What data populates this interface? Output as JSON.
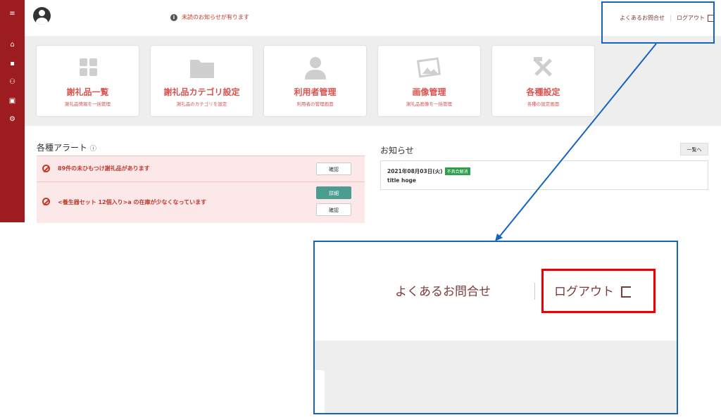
{
  "sidebar": {
    "items": [
      {
        "icon": "menu-icon",
        "glyph": "≡"
      },
      {
        "icon": "home-icon",
        "glyph": "⌂"
      },
      {
        "icon": "grid-icon",
        "glyph": "▪"
      },
      {
        "icon": "users-icon",
        "glyph": "⚇"
      },
      {
        "icon": "image-icon",
        "glyph": "▣"
      },
      {
        "icon": "gear-icon",
        "glyph": "⚙"
      }
    ]
  },
  "header": {
    "notice": "未読のお知らせが有ります",
    "faq_label": "よくあるお問合せ",
    "logout_label": "ログアウト"
  },
  "cards": [
    {
      "icon": "grid-icon",
      "title": "謝礼品一覧",
      "subtitle": "謝礼品情報を一括管理"
    },
    {
      "icon": "folder-icon",
      "title": "謝礼品カテゴリ設定",
      "subtitle": "謝礼品のカテゴリを設定"
    },
    {
      "icon": "user-icon",
      "title": "利用者管理",
      "subtitle": "利用者の管理画面"
    },
    {
      "icon": "image-icon",
      "title": "画像管理",
      "subtitle": "謝礼品画像を一括管理"
    },
    {
      "icon": "tools-icon",
      "title": "各種設定",
      "subtitle": "各種の設定画面"
    }
  ],
  "alerts": {
    "title": "各種アラート",
    "rows": [
      {
        "text": "89件の未ひもつけ謝礼品があります",
        "confirm": "確認"
      },
      {
        "text": "<養生器セット 12個入り>a の在庫が少なくなっています",
        "detail": "詳細",
        "confirm": "確認"
      }
    ]
  },
  "news": {
    "title": "お知らせ",
    "more": "一覧へ",
    "items": [
      {
        "date": "2021年08月03日(火)",
        "badge": "不具合解消",
        "title": "title hoge"
      }
    ]
  },
  "zoom": {
    "faq_label": "よくあるお問合せ",
    "logout_label": "ログアウト"
  },
  "colors": {
    "sidebar": "#9c1c1f",
    "accent": "#d9534f",
    "callout": "#1565c0",
    "highlight": "#ee0000"
  }
}
